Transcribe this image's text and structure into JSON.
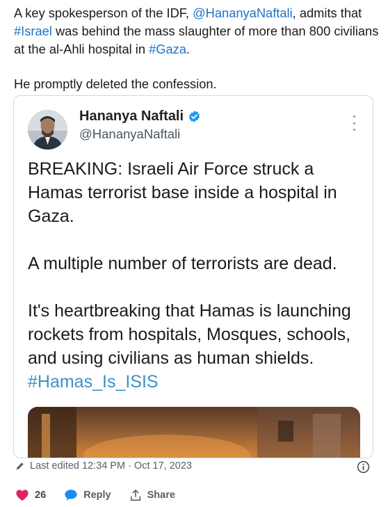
{
  "post": {
    "line1_prefix": "A key spokesperson of the IDF, ",
    "mention": "@HananyaNaftali",
    "line1_suffix": ", admits that ",
    "hashtag_israel": "#Israel",
    "middle": " was behind the mass slaughter of more than 800 civilians at the al-Ahli hospital in ",
    "hashtag_gaza": "#Gaza",
    "end": ".",
    "second_paragraph": "He promptly deleted the confession."
  },
  "quoted_tweet": {
    "author_name": "Hananya Naftali",
    "author_handle": "@HananyaNaftali",
    "paragraph1": "BREAKING: Israeli Air Force struck a Hamas terrorist base inside a hospital in Gaza.",
    "paragraph2": "A multiple number of terrorists are dead.",
    "paragraph3_text": "It's heartbreaking that Hamas is launching rockets from hospitals, Mosques, schools, and using civilians as human shields. ",
    "paragraph3_hashtag": "#Hamas_Is_ISIS"
  },
  "meta": {
    "edited": "Last edited 12:34 PM · Oct 17, 2023"
  },
  "actions": {
    "like_count": "26",
    "reply_label": "Reply",
    "share_label": "Share"
  },
  "colors": {
    "link": "#1d73c9",
    "hashtag": "#3b92c6",
    "like": "#e0245e",
    "reply": "#1d8cf0",
    "verified": "#1d9bf0"
  },
  "icons": [
    "verified-badge-icon",
    "more-options-icon",
    "pencil-icon",
    "info-icon",
    "heart-icon",
    "speech-bubble-icon",
    "share-icon"
  ]
}
